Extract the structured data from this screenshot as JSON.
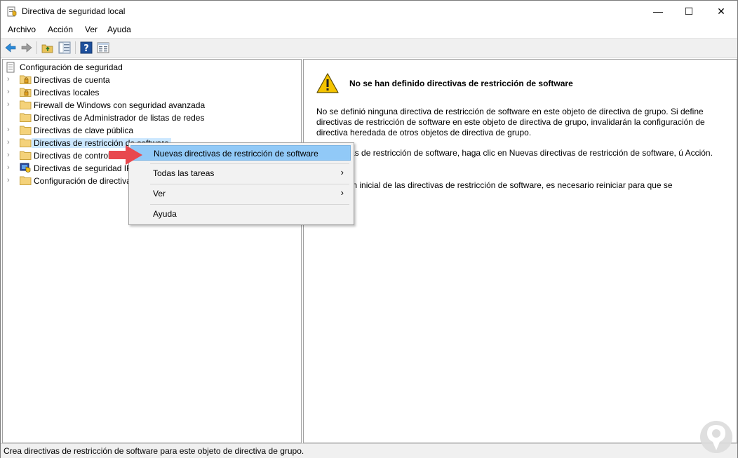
{
  "window": {
    "title": "Directiva de seguridad local",
    "minimize": "—",
    "maximize": "☐",
    "close": "✕"
  },
  "menubar": {
    "items": [
      "Archivo",
      "Acción",
      "Ver",
      "Ayuda"
    ]
  },
  "toolbar": {
    "buttons": [
      "back-icon",
      "forward-icon",
      "up-folder-icon",
      "show-hide-tree-icon",
      "help-icon",
      "properties-icon"
    ]
  },
  "tree": {
    "root": "Configuración de seguridad",
    "items": [
      {
        "label": "Directivas de cuenta",
        "icon": "folder-lock-icon"
      },
      {
        "label": "Directivas locales",
        "icon": "folder-lock-icon"
      },
      {
        "label": "Firewall de Windows con seguridad avanzada",
        "icon": "folder-icon"
      },
      {
        "label": "Directivas de Administrador de listas de redes",
        "icon": "folder-icon"
      },
      {
        "label": "Directivas de clave pública",
        "icon": "folder-icon"
      },
      {
        "label": "Directivas de restricción de software",
        "icon": "folder-icon"
      },
      {
        "label": "Directivas de control de ap",
        "icon": "folder-icon"
      },
      {
        "label": "Directivas de seguridad IP",
        "icon": "ip-security-icon"
      },
      {
        "label": "Configuración de directiva",
        "icon": "folder-icon"
      }
    ]
  },
  "right_pane": {
    "title": "No se han definido directivas de restricción de software",
    "para1": "No se definió ninguna directiva de restricción de software en este objeto de directiva de grupo. Si define directivas de restricción de software en este objeto de directiva de grupo, invalidarán la configuración de directiva heredada de otros objetos de directiva de grupo.",
    "para2": "ir directivas de restricción de software, haga clic en Nuevas directivas de restricción de software, ú Acción.",
    "para3": "la creación inicial de las directivas de restricción de software, es necesario reiniciar para que se"
  },
  "context_menu": {
    "items": [
      {
        "label": "Nuevas directivas de restricción de software",
        "submenu": false,
        "highlighted": true
      },
      {
        "label": "Todas las tareas",
        "submenu": true,
        "highlighted": false
      },
      {
        "label": "Ver",
        "submenu": true,
        "highlighted": false
      },
      {
        "label": "Ayuda",
        "submenu": false,
        "highlighted": false
      }
    ],
    "submenu_glyph": "›"
  },
  "statusbar": {
    "text": "Crea directivas de restricción de software para este objeto de directiva de grupo."
  },
  "colors": {
    "selection": "#cce8ff",
    "menu_highlight": "#91c9f7",
    "pointer_arrow": "#e8484e",
    "warning": "#f5c400"
  }
}
